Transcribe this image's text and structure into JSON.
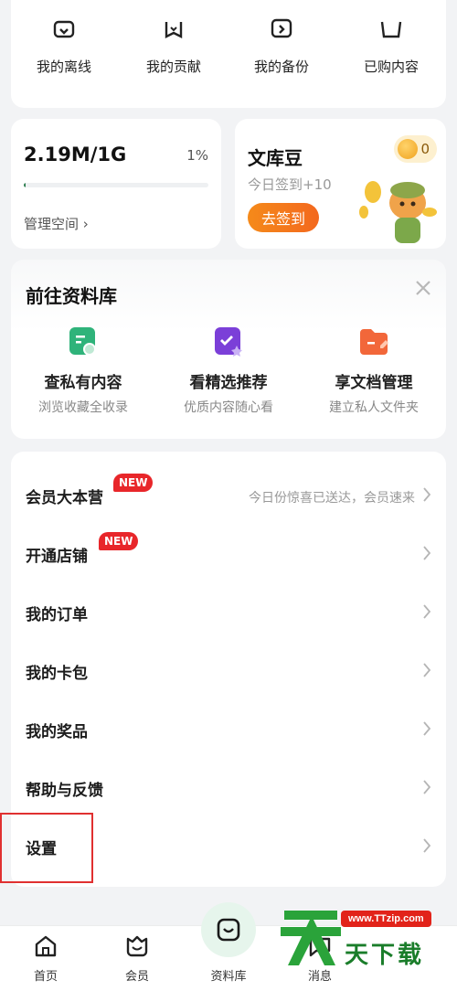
{
  "quick_row": {
    "items": [
      {
        "label": "我的离线",
        "icon": "offline-icon"
      },
      {
        "label": "我的贡献",
        "icon": "contribution-icon"
      },
      {
        "label": "我的备份",
        "icon": "backup-icon"
      },
      {
        "label": "已购内容",
        "icon": "purchased-icon"
      }
    ]
  },
  "storage": {
    "value": "2.19M/1G",
    "percent": "1%",
    "progress": 0.01,
    "manage_label": "管理空间 ›"
  },
  "bean": {
    "title": "文库豆",
    "subtitle": "今日签到+10",
    "button": "去签到",
    "coins": "0"
  },
  "library": {
    "title": "前往资料库",
    "items": [
      {
        "name": "查私有内容",
        "desc": "浏览收藏全收录",
        "icon": "private-content-icon"
      },
      {
        "name": "看精选推荐",
        "desc": "优质内容随心看",
        "icon": "featured-icon"
      },
      {
        "name": "享文档管理",
        "desc": "建立私人文件夹",
        "icon": "folder-icon"
      }
    ]
  },
  "menu": {
    "items": [
      {
        "label": "会员大本营",
        "badge": "NEW",
        "hint": "今日份惊喜已送达，会员速来"
      },
      {
        "label": "开通店铺",
        "badge": "NEW",
        "hint": ""
      },
      {
        "label": "我的订单",
        "badge": "",
        "hint": ""
      },
      {
        "label": "我的卡包",
        "badge": "",
        "hint": ""
      },
      {
        "label": "我的奖品",
        "badge": "",
        "hint": ""
      },
      {
        "label": "帮助与反馈",
        "badge": "",
        "hint": ""
      },
      {
        "label": "设置",
        "badge": "",
        "hint": ""
      }
    ]
  },
  "bottom_nav": {
    "items": [
      {
        "label": "首页",
        "icon": "home-icon"
      },
      {
        "label": "会员",
        "icon": "member-icon"
      },
      {
        "label": "资料库",
        "icon": "library-icon"
      },
      {
        "label": "消息",
        "icon": "message-icon"
      }
    ]
  },
  "watermark": {
    "url": "www.TTzip.com",
    "text": "天下载"
  },
  "colors": {
    "accent_green": "#2d7e4f",
    "new_badge": "#e8262a",
    "checkin_orange": "#f3681e"
  }
}
